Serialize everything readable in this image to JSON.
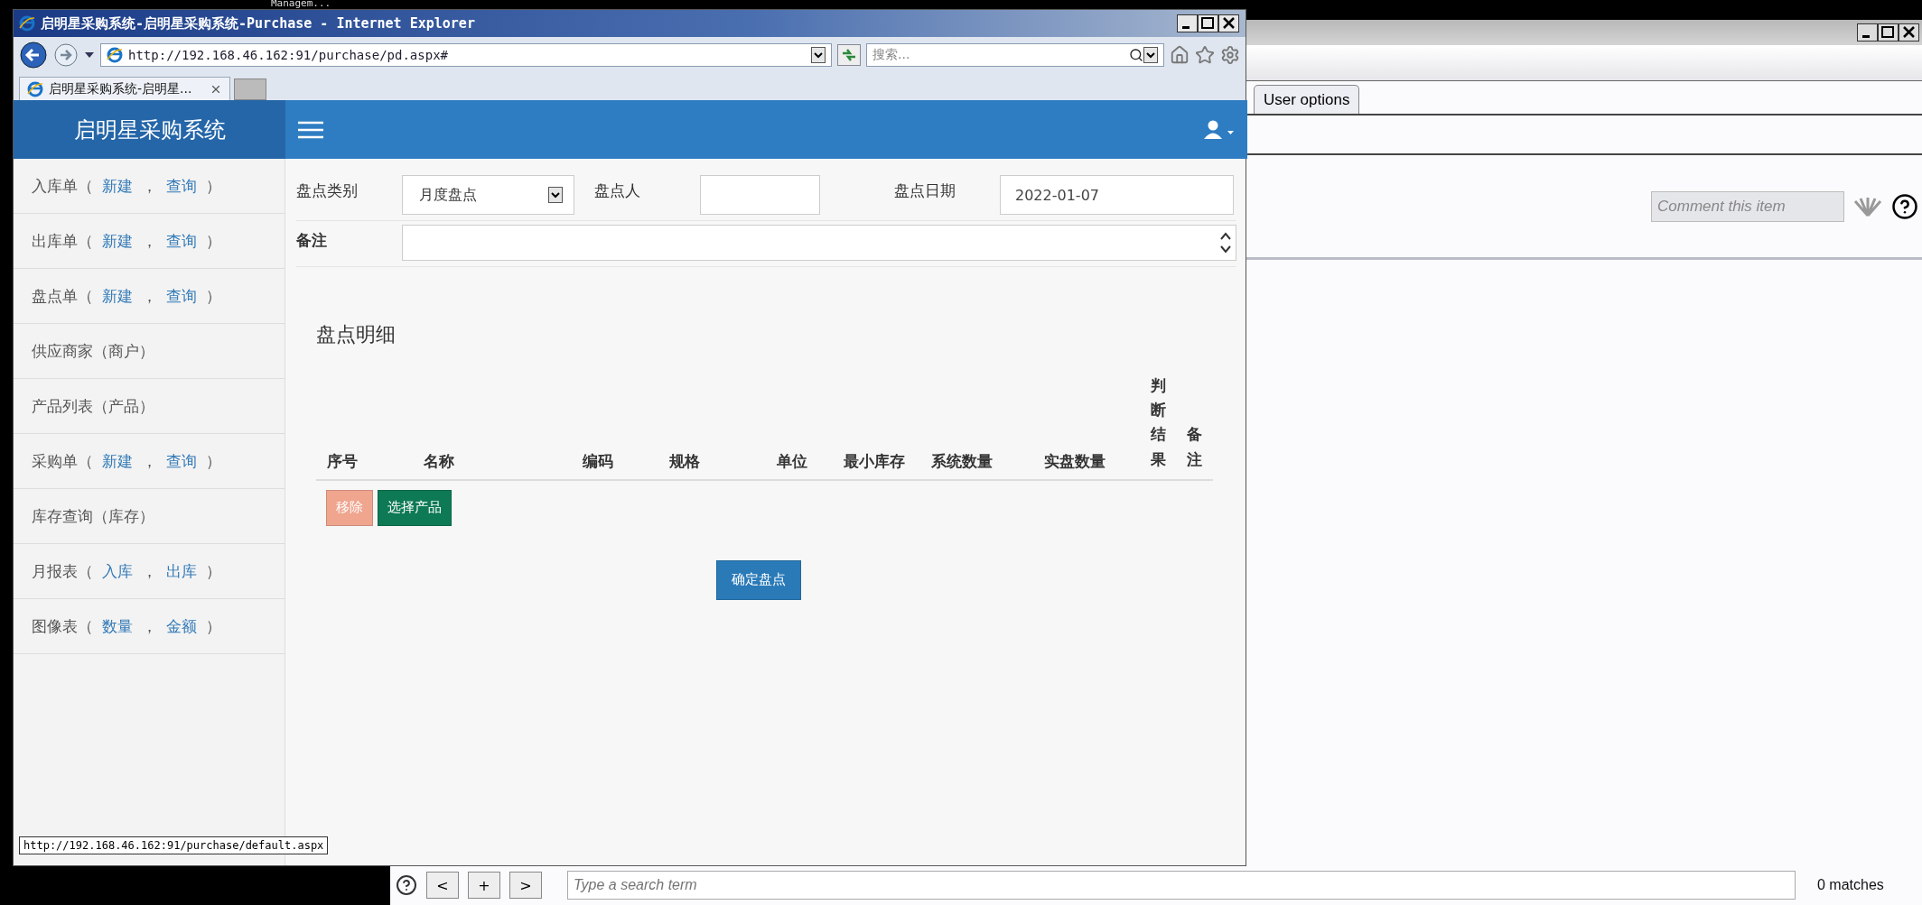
{
  "desktop": {
    "caption": "Managem..."
  },
  "browser": {
    "title": "启明星采购系统-启明星采购系统-Purchase - Internet Explorer",
    "address": "http://192.168.46.162:91/purchase/pd.aspx#",
    "search_placeholder": "搜索...",
    "tabs": [
      {
        "label": "启明星采购系统-启明星...",
        "selected": true
      }
    ],
    "status_url": "http://192.168.46.162:91/purchase/default.aspx"
  },
  "app": {
    "brand": "启明星采购系统",
    "nav": [
      {
        "kind": "links",
        "label": "入库单（",
        "links": [
          "新建",
          "查询"
        ],
        "separator": "，",
        "close": "）"
      },
      {
        "kind": "links",
        "label": "出库单（",
        "links": [
          "新建",
          "查询"
        ],
        "separator": "，",
        "close": "）"
      },
      {
        "kind": "links",
        "label": "盘点单（",
        "links": [
          "新建",
          "查询"
        ],
        "separator": "，",
        "close": "）"
      },
      {
        "kind": "plain",
        "label": "供应商家（商户）"
      },
      {
        "kind": "plain",
        "label": "产品列表（产品）"
      },
      {
        "kind": "links",
        "label": "采购单（",
        "links": [
          "新建",
          "查询"
        ],
        "separator": "，",
        "close": "）"
      },
      {
        "kind": "plain",
        "label": "库存查询（库存）"
      },
      {
        "kind": "links",
        "label": "月报表（",
        "links": [
          "入库",
          "出库"
        ],
        "separator": "，",
        "close": "）"
      },
      {
        "kind": "links",
        "label": "图像表（",
        "links": [
          "数量",
          "金额"
        ],
        "separator": "，",
        "close": "）"
      }
    ],
    "form": {
      "category_label": "盘点类别",
      "category_value": "月度盘点",
      "person_label": "盘点人",
      "date_label": "盘点日期",
      "date_value": "2022-01-07",
      "note_label": "备注"
    },
    "detail_title": "盘点明细",
    "columns": [
      "序号",
      "名称",
      "编码",
      "规格",
      "单位",
      "最小库存",
      "系统数量",
      "实盘数量",
      "判断结果",
      "备注"
    ],
    "remove_button": "移除",
    "select_button": "选择产品",
    "confirm_button": "确定盘点"
  },
  "back_window": {
    "tabs": [
      {
        "label": "User options",
        "selected": true
      }
    ],
    "comment_placeholder": "Comment this item",
    "nav_buttons": [
      "<",
      "+",
      ">"
    ],
    "search_placeholder": "Type a search term",
    "matches": "0 matches"
  }
}
